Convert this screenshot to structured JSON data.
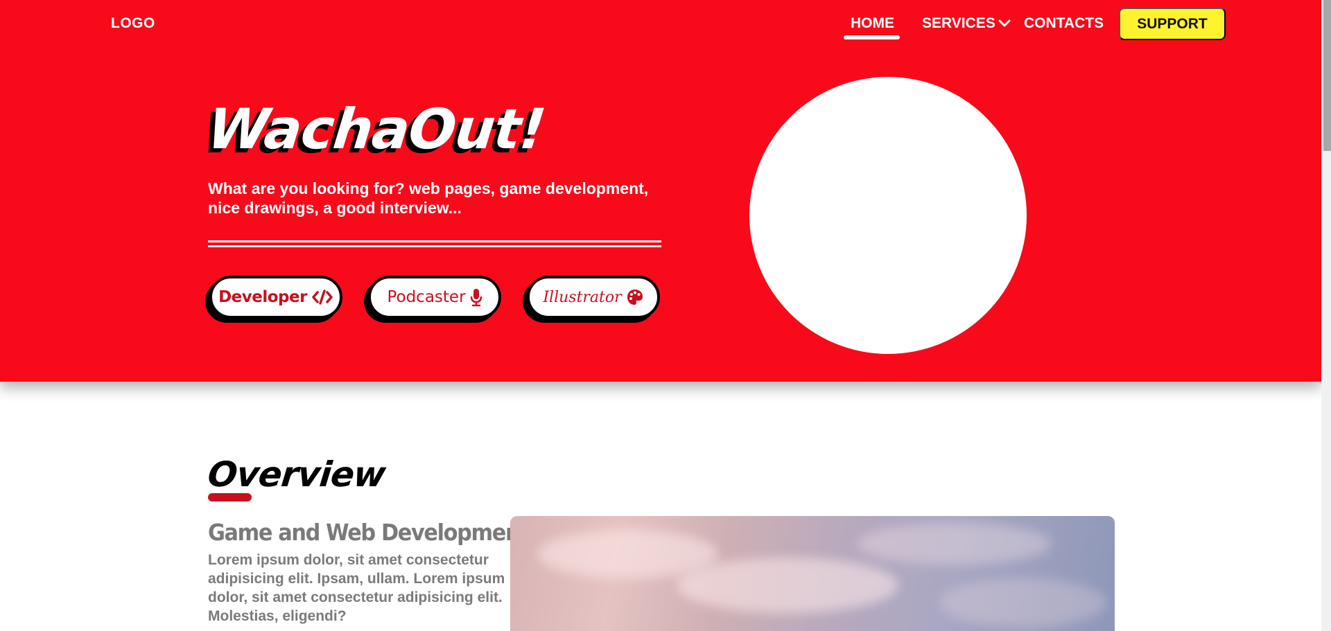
{
  "nav": {
    "logo": "LOGO",
    "items": [
      {
        "label": "HOME",
        "active": true
      },
      {
        "label": "SERVICES",
        "has_dropdown": true
      },
      {
        "label": "CONTACTS"
      }
    ],
    "support_label": "SUPPORT"
  },
  "hero": {
    "title": "WachaOut!",
    "subtitle": "What are you looking for? web pages, game development, nice drawings, a good interview...",
    "roles": [
      {
        "label": "Developer",
        "icon": "code-icon"
      },
      {
        "label": "Podcaster",
        "icon": "microphone-icon"
      },
      {
        "label": "Illustrator",
        "icon": "palette-icon"
      }
    ]
  },
  "overview": {
    "title": "Overview",
    "heading": "Game and Web Development",
    "body": "Lorem ipsum dolor, sit amet consectetur adipisicing elit. Ipsam, ullam. Lorem ipsum dolor, sit amet consectetur adipisicing elit. Molestias, eligendi?"
  },
  "colors": {
    "brand_red": "#f90a1a",
    "accent_red": "#c8101e",
    "support_yellow": "#fff22e",
    "text_gray": "#7a7a7a"
  }
}
